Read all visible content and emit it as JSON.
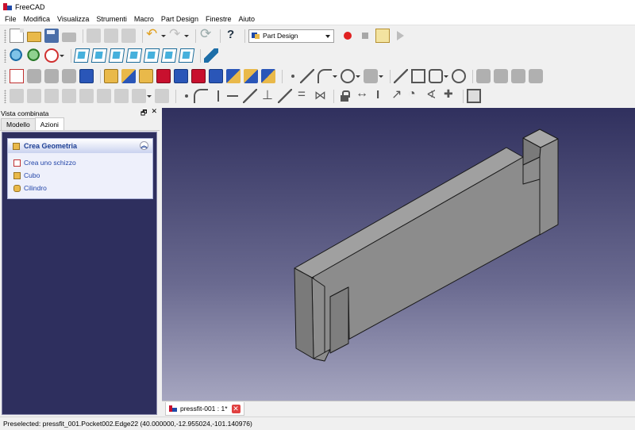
{
  "window": {
    "title": "FreeCAD",
    "icon": "freecad-logo-icon"
  },
  "menu": [
    "File",
    "Modifica",
    "Visualizza",
    "Strumenti",
    "Macro",
    "Part Design",
    "Finestre",
    "Aiuto"
  ],
  "toolbar": {
    "workbench": "Part Design"
  },
  "combo_view": {
    "title": "Vista combinata",
    "tabs": [
      "Modello",
      "Azioni"
    ],
    "active_tab": "Azioni",
    "task_panel": {
      "title": "Crea Geometria",
      "items": [
        "Crea uno schizzo",
        "Cubo",
        "Cilindro"
      ]
    }
  },
  "document_tab": {
    "label": "pressfit-001 : 1*"
  },
  "status": {
    "text": "Preselected: pressfit_001.Pocket002.Edge22 (40.000000,-12.955024,-101.140976)"
  },
  "colors": {
    "model_face": "#8c8c8c",
    "background_top": "#30305e",
    "background_bottom": "#a6a6c0",
    "accent": "#2144a8"
  }
}
